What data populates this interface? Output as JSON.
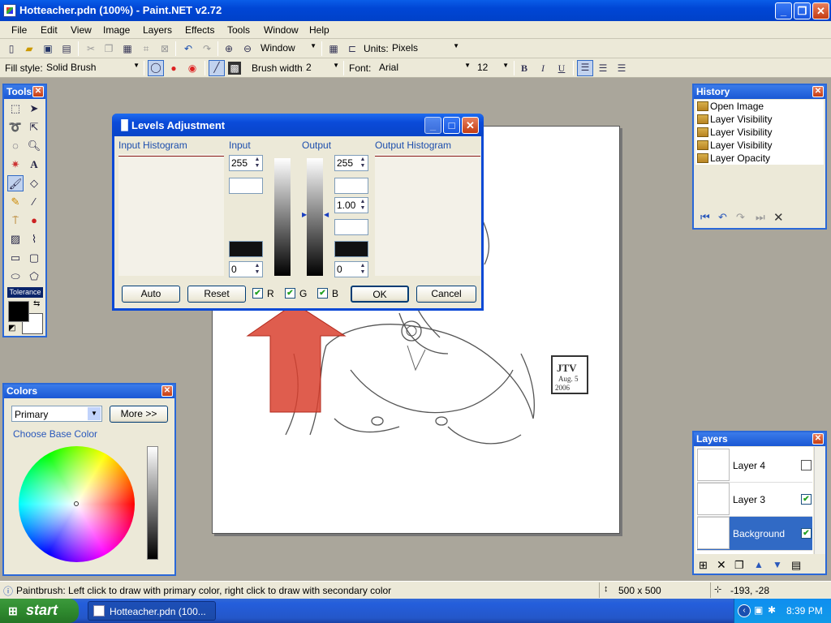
{
  "app": {
    "window_title": "Hotteacher.pdn (100%) - Paint.NET v2.72"
  },
  "menu": [
    "File",
    "Edit",
    "View",
    "Image",
    "Layers",
    "Effects",
    "Tools",
    "Window",
    "Help"
  ],
  "toolbar1": {
    "window_combo": "Window",
    "units_label": "Units:",
    "units_value": "Pixels"
  },
  "toolbar2": {
    "fill_style_label": "Fill style:",
    "fill_style_value": "Solid Brush",
    "brush_width_label": "Brush width:",
    "brush_width_value": "2",
    "font_label": "Font:",
    "font_value": "Arial",
    "font_size": "12",
    "bold": "B",
    "italic": "I",
    "underline": "U"
  },
  "tools_panel": {
    "title": "Tools",
    "tolerance_label": "Tolerance"
  },
  "colors_panel": {
    "title": "Colors",
    "mode": "Primary",
    "more_button": "More >>",
    "choose_label": "Choose Base Color",
    "primary_color": "#000000",
    "secondary_color": "#ffffff"
  },
  "history_panel": {
    "title": "History",
    "items": [
      "Open Image",
      "Layer Visibility",
      "Layer Visibility",
      "Layer Visibility",
      "Layer Opacity"
    ]
  },
  "layers_panel": {
    "title": "Layers",
    "layers": [
      {
        "name": "Layer 4",
        "visible": false,
        "selected": false
      },
      {
        "name": "Layer 3",
        "visible": true,
        "selected": false
      },
      {
        "name": "Background",
        "visible": true,
        "selected": true
      }
    ]
  },
  "dialog": {
    "title": "Levels Adjustment",
    "input_histogram_label": "Input Histogram",
    "input_label": "Input",
    "output_label": "Output",
    "output_histogram_label": "Output Histogram",
    "input_high": "255",
    "input_low": "0",
    "output_high": "255",
    "output_gamma": "1.00",
    "output_low": "0",
    "auto_button": "Auto",
    "reset_button": "Reset",
    "channel_r": "R",
    "channel_g": "G",
    "channel_b": "B",
    "ok_button": "OK",
    "cancel_button": "Cancel"
  },
  "canvas": {
    "signature_lines": [
      "JTV",
      "Aug. 5",
      "2006"
    ]
  },
  "status": {
    "hint": "Paintbrush: Left click to draw with primary color, right click to draw with secondary color",
    "image_size": "500 x 500",
    "cursor_pos": "-193, -28"
  },
  "taskbar": {
    "start_label": "start",
    "task_label": "Hotteacher.pdn (100...",
    "clock": "8:39 PM"
  },
  "accent_colors": {
    "xp_blue": "#0a5de8",
    "selection_blue": "#316ac5",
    "arrow_red": "#d9412f"
  }
}
